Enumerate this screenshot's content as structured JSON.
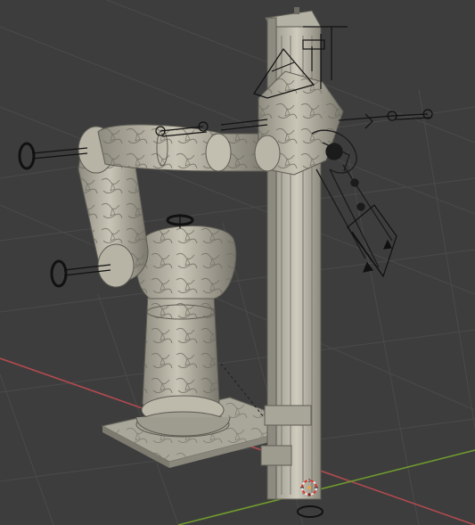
{
  "viewport": {
    "background": "#3d3d3d",
    "grid_color": "#4a4a4a",
    "x_axis_color": "#b34a50",
    "y_axis_color": "#6f9a2e"
  },
  "scene": {
    "objects": [
      {
        "name": "robot-base-plate",
        "material": "mesh-textured-grey"
      },
      {
        "name": "robot-column-base",
        "material": "mesh-textured-grey"
      },
      {
        "name": "robot-shoulder",
        "material": "mesh-textured-grey"
      },
      {
        "name": "robot-upper-arm",
        "material": "mesh-textured-grey"
      },
      {
        "name": "robot-forearm",
        "material": "mesh-textured-grey"
      },
      {
        "name": "robot-wrist",
        "material": "mesh-textured-grey"
      },
      {
        "name": "vertical-linear-rail",
        "material": "mesh-textured-grey"
      },
      {
        "name": "end-effector-gripper",
        "material": "mesh-dark"
      },
      {
        "name": "joint-gizmos",
        "material": "wireframe"
      }
    ],
    "cursor_icon": "3d-cursor-icon",
    "icons": [
      "joint-ring-icon",
      "axis-arrow-icon",
      "camera-frustum-icon"
    ]
  }
}
